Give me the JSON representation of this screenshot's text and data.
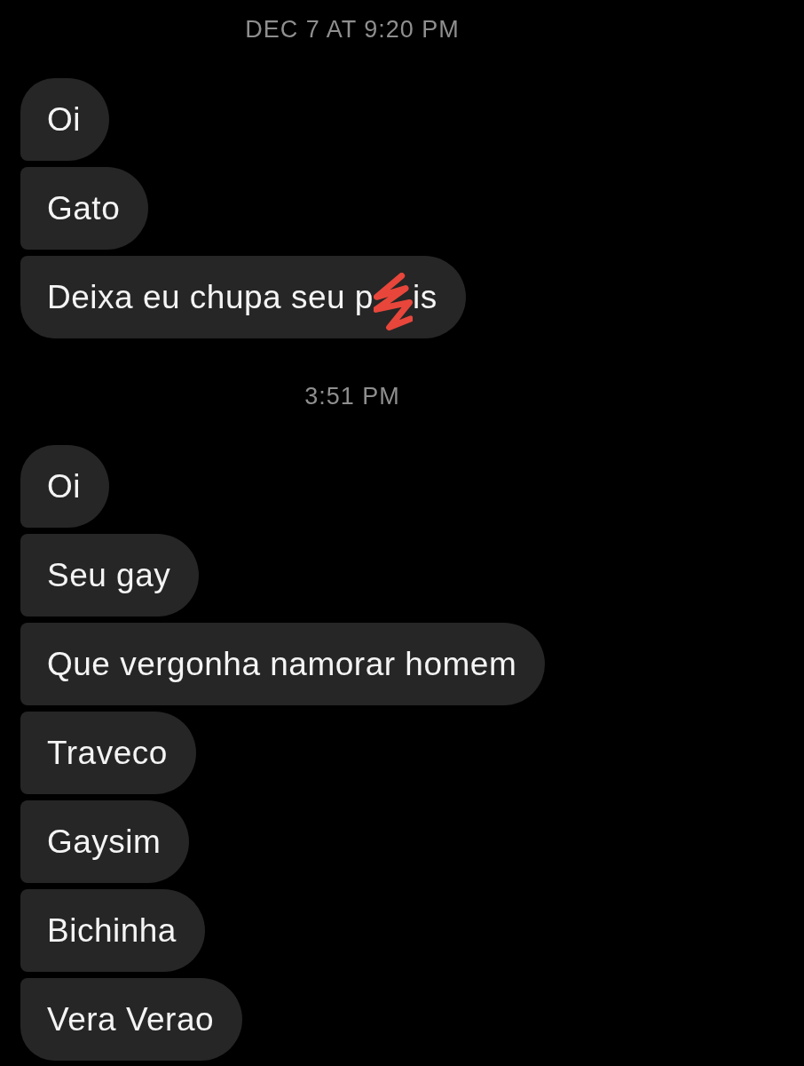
{
  "sections": [
    {
      "timestamp": "DEC 7 AT 9:20 PM",
      "messages": [
        {
          "parts": [
            {
              "kind": "text",
              "text": "Oi"
            }
          ]
        },
        {
          "parts": [
            {
              "kind": "text",
              "text": "Gato"
            }
          ]
        },
        {
          "parts": [
            {
              "kind": "text",
              "text": "Deixa eu chupa seu p"
            },
            {
              "kind": "scribble"
            },
            {
              "kind": "text",
              "text": "is"
            }
          ]
        }
      ]
    },
    {
      "timestamp": "3:51 PM",
      "messages": [
        {
          "parts": [
            {
              "kind": "text",
              "text": "Oi"
            }
          ]
        },
        {
          "parts": [
            {
              "kind": "text",
              "text": "Seu gay"
            }
          ]
        },
        {
          "parts": [
            {
              "kind": "text",
              "text": "Que vergonha namorar homem"
            }
          ]
        },
        {
          "parts": [
            {
              "kind": "text",
              "text": "Traveco"
            }
          ]
        },
        {
          "parts": [
            {
              "kind": "text",
              "text": "Gaysim"
            }
          ]
        },
        {
          "parts": [
            {
              "kind": "text",
              "text": "Bichinha"
            }
          ]
        },
        {
          "parts": [
            {
              "kind": "text",
              "text": "Vera Verao"
            }
          ]
        }
      ]
    }
  ]
}
